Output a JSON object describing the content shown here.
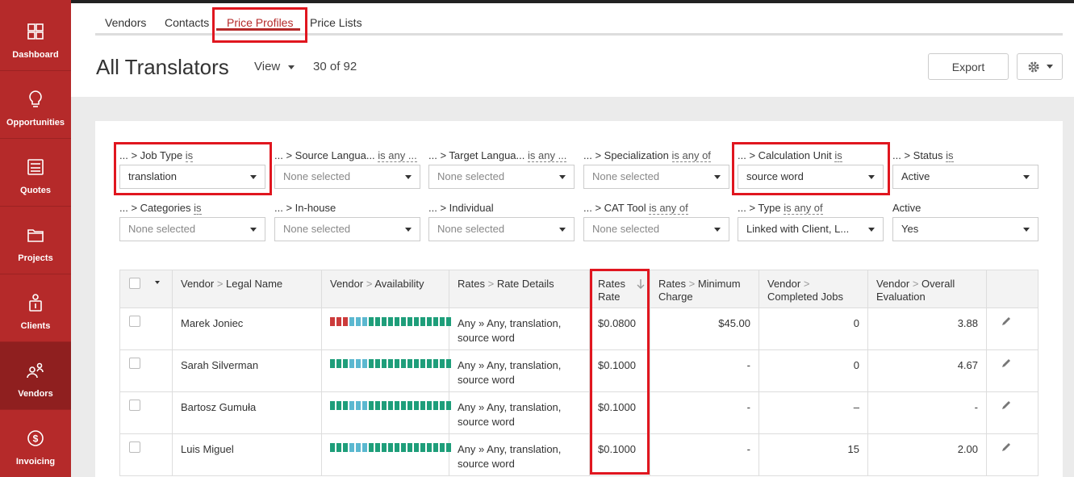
{
  "sidebar": {
    "items": [
      {
        "label": "Dashboard",
        "icon": "dashboard-icon"
      },
      {
        "label": "Opportunities",
        "icon": "lightbulb-icon"
      },
      {
        "label": "Quotes",
        "icon": "calculator-icon"
      },
      {
        "label": "Projects",
        "icon": "folder-icon"
      },
      {
        "label": "Clients",
        "icon": "client-icon"
      },
      {
        "label": "Vendors",
        "icon": "vendors-icon",
        "active": true
      },
      {
        "label": "Invoicing",
        "icon": "dollar-icon"
      }
    ]
  },
  "tabs": [
    {
      "label": "Vendors"
    },
    {
      "label": "Contacts"
    },
    {
      "label": "Price Profiles",
      "active": true
    },
    {
      "label": "Price Lists"
    }
  ],
  "header": {
    "title": "All Translators",
    "view_label": "View",
    "count": "30 of 92",
    "export_label": "Export"
  },
  "filters": [
    {
      "label": "... > Job Type",
      "op": "is",
      "value": "translation"
    },
    {
      "label": "... > Source Langua...",
      "op": "is any ...",
      "value": "None selected"
    },
    {
      "label": "... > Target Langua...",
      "op": "is any ...",
      "value": "None selected"
    },
    {
      "label": "... > Specialization",
      "op": "is any of",
      "value": "None selected"
    },
    {
      "label": "... > Calculation Unit",
      "op": "is",
      "value": "source word"
    },
    {
      "label": "... > Status",
      "op": "is",
      "value": "Active"
    },
    {
      "label": "... > Categories",
      "op": "is",
      "value": "None selected"
    },
    {
      "label": "... > In-house",
      "op": "",
      "value": "None selected"
    },
    {
      "label": "... > Individual",
      "op": "",
      "value": "None selected"
    },
    {
      "label": "... > CAT Tool",
      "op": "is any of",
      "value": "None selected"
    },
    {
      "label": "... > Type",
      "op": "is any of",
      "value": "Linked with Client, L..."
    },
    {
      "label": "Active",
      "op": "",
      "value": "Yes"
    }
  ],
  "table": {
    "headers": {
      "legal_name": {
        "a": "Vendor",
        "b": "Legal Name"
      },
      "availability": {
        "a": "Vendor",
        "b": "Availability"
      },
      "rate_details": {
        "a": "Rates",
        "b": "Rate Details"
      },
      "rate": {
        "a": "Rates",
        "b": "Rate"
      },
      "min_charge": {
        "a": "Rates",
        "b": "Minimum",
        "c": "Charge"
      },
      "completed_jobs": {
        "a": "Vendor",
        "b": "Completed Jobs"
      },
      "evaluation": {
        "a": "Vendor",
        "b": "Overall",
        "c": "Evaluation"
      }
    },
    "rows": [
      {
        "name": "Marek Joniec",
        "details": "Any » Any, translation,",
        "details2": "source word",
        "rate": "$0.0800",
        "min_charge": "$45.00",
        "jobs": "0",
        "evaluation": "3.88",
        "availability": [
          "r",
          "r",
          "r",
          "b",
          "b",
          "b",
          "g",
          "g",
          "g",
          "g",
          "g",
          "g",
          "g",
          "g",
          "g",
          "g",
          "g",
          "g",
          "g"
        ]
      },
      {
        "name": "Sarah Silverman",
        "details": "Any » Any, translation,",
        "details2": "source word",
        "rate": "$0.1000",
        "min_charge": "-",
        "jobs": "0",
        "evaluation": "4.67",
        "availability": [
          "g",
          "g",
          "g",
          "b",
          "b",
          "b",
          "g",
          "g",
          "g",
          "g",
          "g",
          "g",
          "g",
          "g",
          "g",
          "g",
          "g",
          "g",
          "g"
        ]
      },
      {
        "name": "Bartosz Gumuła",
        "details": "Any » Any, translation,",
        "details2": "source word",
        "rate": "$0.1000",
        "min_charge": "-",
        "jobs": "–",
        "evaluation": "-",
        "availability": [
          "g",
          "g",
          "g",
          "b",
          "b",
          "b",
          "g",
          "g",
          "g",
          "g",
          "g",
          "g",
          "g",
          "g",
          "g",
          "g",
          "g",
          "g",
          "g"
        ]
      },
      {
        "name": "Luis Miguel",
        "details": "Any » Any, translation,",
        "details2": "source word",
        "rate": "$0.1000",
        "min_charge": "-",
        "jobs": "15",
        "evaluation": "2.00",
        "availability": [
          "g",
          "g",
          "g",
          "b",
          "b",
          "b",
          "g",
          "g",
          "g",
          "g",
          "g",
          "g",
          "g",
          "g",
          "g",
          "g",
          "g",
          "g",
          "g"
        ]
      }
    ]
  },
  "colors": {
    "brand": "#b52a2a",
    "highlight": "#e0161f",
    "avail_red": "#cc3b3b",
    "avail_blue": "#5bb8d0",
    "avail_green": "#1e9e7a"
  }
}
